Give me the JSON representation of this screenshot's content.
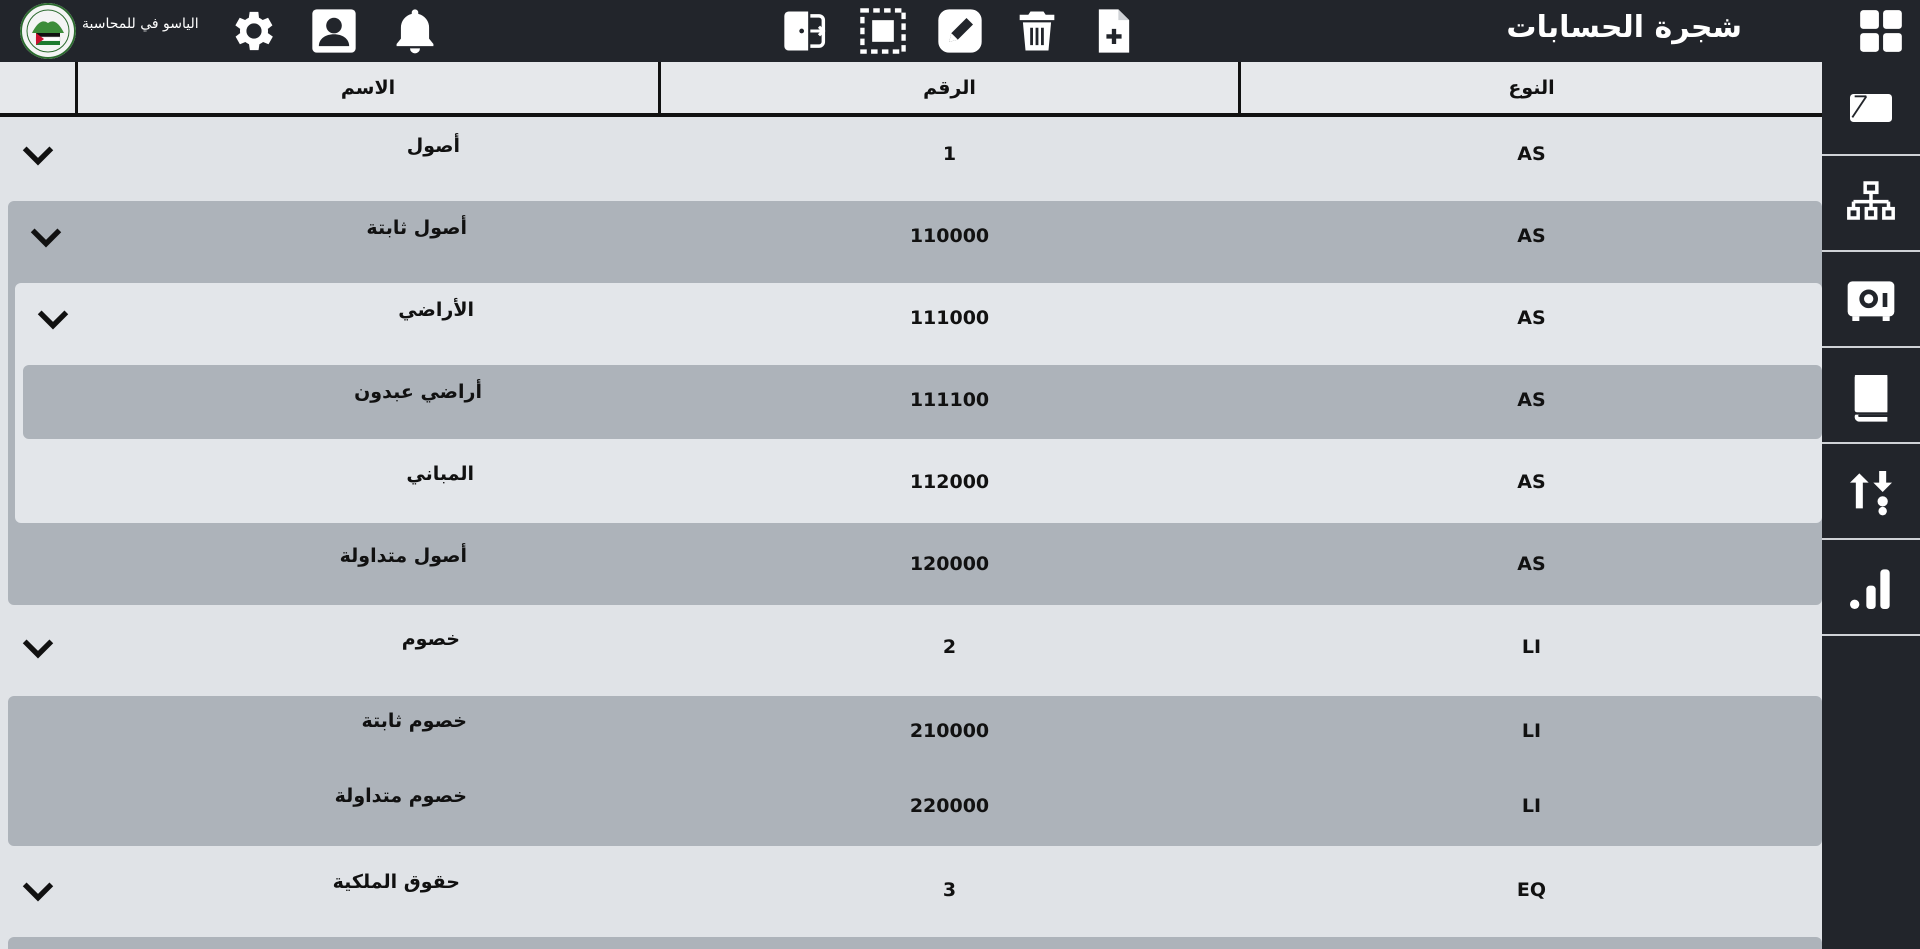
{
  "header": {
    "logo_text": "الياسو في للمحاسبة",
    "title": "شجرة الحسابات",
    "icons": {
      "settings": "gear-icon",
      "user": "user-icon",
      "notifications": "bell-icon",
      "exit": "exit-icon",
      "select": "select-icon",
      "edit": "edit-icon",
      "delete": "trash-icon",
      "new": "add-file-icon",
      "apps": "apps-grid-icon"
    }
  },
  "sidebar": {
    "items": [
      {
        "icon": "vouchers-icon"
      },
      {
        "icon": "account-tree-icon"
      },
      {
        "icon": "cash-box-icon"
      },
      {
        "icon": "ledger-book-icon"
      },
      {
        "icon": "transfer-icon"
      },
      {
        "icon": "reports-chart-icon"
      }
    ]
  },
  "table": {
    "columns": {
      "name": "الاسم",
      "number": "الرقم",
      "type": "النوع"
    },
    "rows": [
      {
        "name": "أصول",
        "number": "1",
        "type": "AS",
        "expandable": true
      },
      {
        "name": "أصول ثابتة",
        "number": "110000",
        "type": "AS",
        "expandable": true
      },
      {
        "name": "الأراضي",
        "number": "111000",
        "type": "AS",
        "expandable": true
      },
      {
        "name": "أراضي عبدون",
        "number": "111100",
        "type": "AS",
        "expandable": false
      },
      {
        "name": "المباني",
        "number": "112000",
        "type": "AS",
        "expandable": false
      },
      {
        "name": "أصول متداولة",
        "number": "120000",
        "type": "AS",
        "expandable": false
      },
      {
        "name": "خصوم",
        "number": "2",
        "type": "LI",
        "expandable": true
      },
      {
        "name": "خصوم ثابتة",
        "number": "210000",
        "type": "LI",
        "expandable": false
      },
      {
        "name": "خصوم متداولة",
        "number": "220000",
        "type": "LI",
        "expandable": false
      },
      {
        "name": "حقوق الملكية",
        "number": "3",
        "type": "EQ",
        "expandable": true
      }
    ]
  },
  "colors": {
    "topbar": "#22252b",
    "band_dark": "#adb3ba",
    "band_light": "#e3e6ea",
    "background": "#e0e3e7"
  }
}
